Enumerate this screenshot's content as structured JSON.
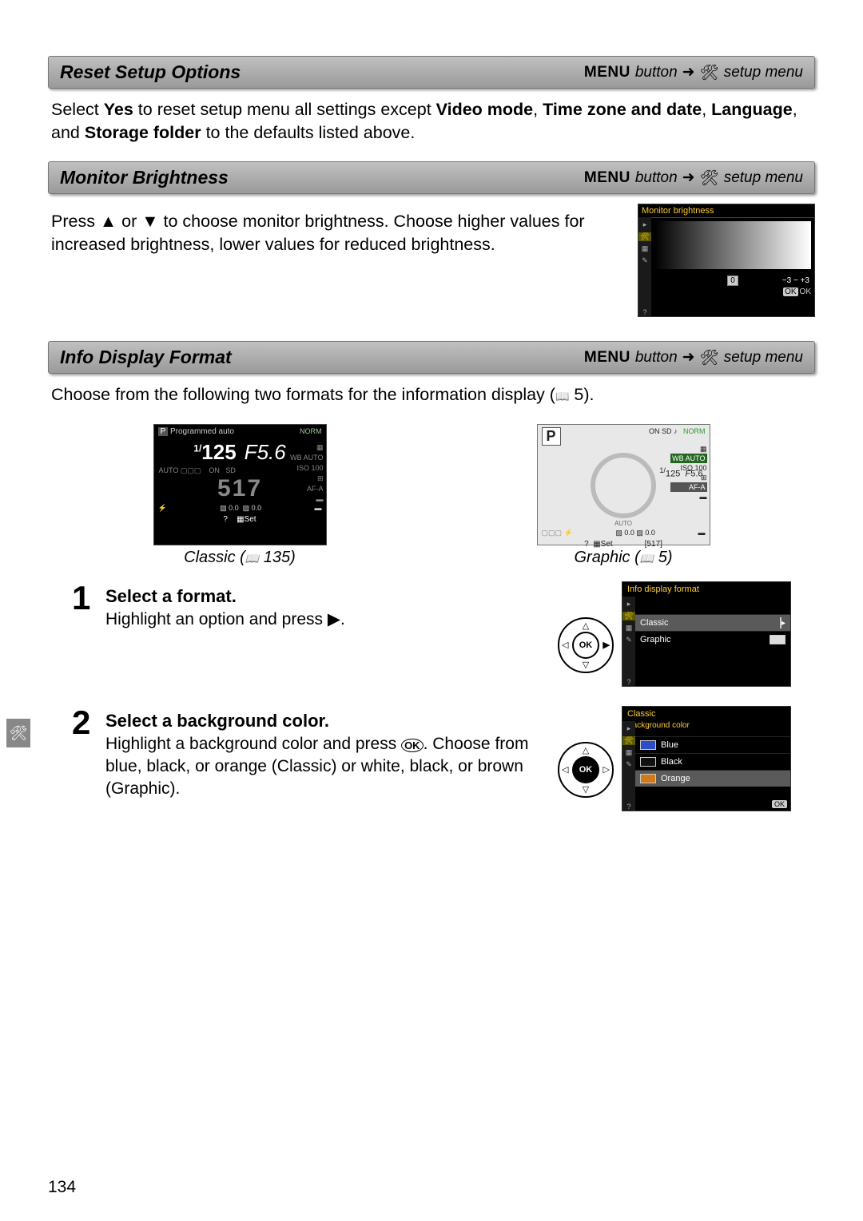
{
  "sections": {
    "reset": {
      "title": "Reset Setup Options",
      "crumb_menu": "MENU",
      "crumb_button": "button",
      "crumb_target": "setup menu",
      "body_pre": "Select ",
      "body_yes": "Yes",
      "body_mid": " to reset setup menu all settings except ",
      "body_video": "Video mode",
      "body_sep1": ", ",
      "body_tz": "Time zone and date",
      "body_sep2": ", ",
      "body_lang": "Language",
      "body_sep3": ", and ",
      "body_storage": "Storage folder",
      "body_end": " to the defaults listed above."
    },
    "brightness": {
      "title": "Monitor Brightness",
      "crumb_menu": "MENU",
      "crumb_button": "button",
      "crumb_target": "setup menu",
      "body": "Press ▲ or ▼ to choose monitor brightness.  Choose higher values for increased brightness, lower values for reduced brightness.",
      "ss_title": "Monitor brightness",
      "ss_value": "0",
      "ss_scale_lo": "−3",
      "ss_scale_mid": "−",
      "ss_scale_hi": "+3",
      "ss_ok": "OK"
    },
    "info": {
      "title": "Info Display Format",
      "crumb_menu": "MENU",
      "crumb_button": "button",
      "crumb_target": "setup menu",
      "intro_a": "Choose from the following two formats for the information display (",
      "intro_page": " 5).",
      "classic": {
        "label": "Classic (",
        "page": " 135)",
        "mode_badge": "P",
        "mode_text": "Programmed auto",
        "qual": "NORM",
        "shutter_pre": "1/",
        "shutter": "125",
        "f_pre": "F",
        "aperture": "5.6",
        "wb": "AUTO",
        "iso": "100",
        "count": "517",
        "afa": "AF-A",
        "ev": "0.0",
        "flash": "0.0",
        "set": "Set"
      },
      "graphic": {
        "label": "Graphic (",
        "page": " 5)",
        "mode_badge": "P",
        "qual": "NORM",
        "shutter_pre": "1/",
        "shutter": "125",
        "f_pre": "F",
        "aperture": "5.6",
        "wb": "AUTO",
        "iso": "100",
        "afa": "AF-A",
        "auto": "AUTO",
        "ev": "0.0",
        "flash": "0.0",
        "count": "[517]",
        "set": "Set"
      }
    },
    "step1": {
      "num": "1",
      "title": "Select a format.",
      "text": "Highlight an option and press ▶.",
      "ss_title": "Info display format",
      "opt_classic": "Classic",
      "opt_graphic": "Graphic",
      "ok": "OK"
    },
    "step2": {
      "num": "2",
      "title": "Select a background color.",
      "text_a": "Highlight a background color and press ",
      "text_b": ". Choose from blue, black, or orange (Classic) or white, black, or brown (Graphic).",
      "ss_title": "Classic",
      "ss_sub": "Background color",
      "opt_blue": "Blue",
      "opt_black": "Black",
      "opt_orange": "Orange",
      "ok": "OK"
    }
  },
  "page_number": "134"
}
